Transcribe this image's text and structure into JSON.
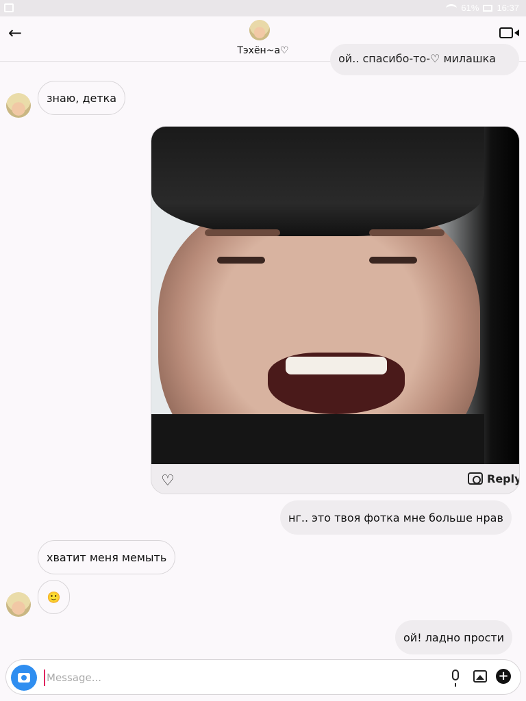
{
  "status_bar": {
    "battery": "61%",
    "time": "16:37"
  },
  "header": {
    "back_icon": "←",
    "contact_name": "Тэхён~а♡"
  },
  "messages": [
    {
      "from": "me",
      "text": "ой.. спасибо-то-♡ милашка"
    },
    {
      "from": "them",
      "text": "знаю, детка"
    },
    {
      "from": "me",
      "type": "photo",
      "actions": {
        "like_icon": "♡",
        "reply_label": "Reply"
      }
    },
    {
      "from": "me",
      "text": "нг.. это твоя фотка мне больше нрав"
    },
    {
      "from": "them",
      "text": "хватит меня мемыть"
    },
    {
      "from": "them",
      "text": "🙂"
    },
    {
      "from": "me",
      "text": "ой! ладно прости"
    }
  ],
  "composer": {
    "placeholder": "Message..."
  },
  "colors": {
    "accent": "#2f8ef0",
    "background": "#fbf8fb",
    "outgoing_bubble": "#efecef"
  }
}
